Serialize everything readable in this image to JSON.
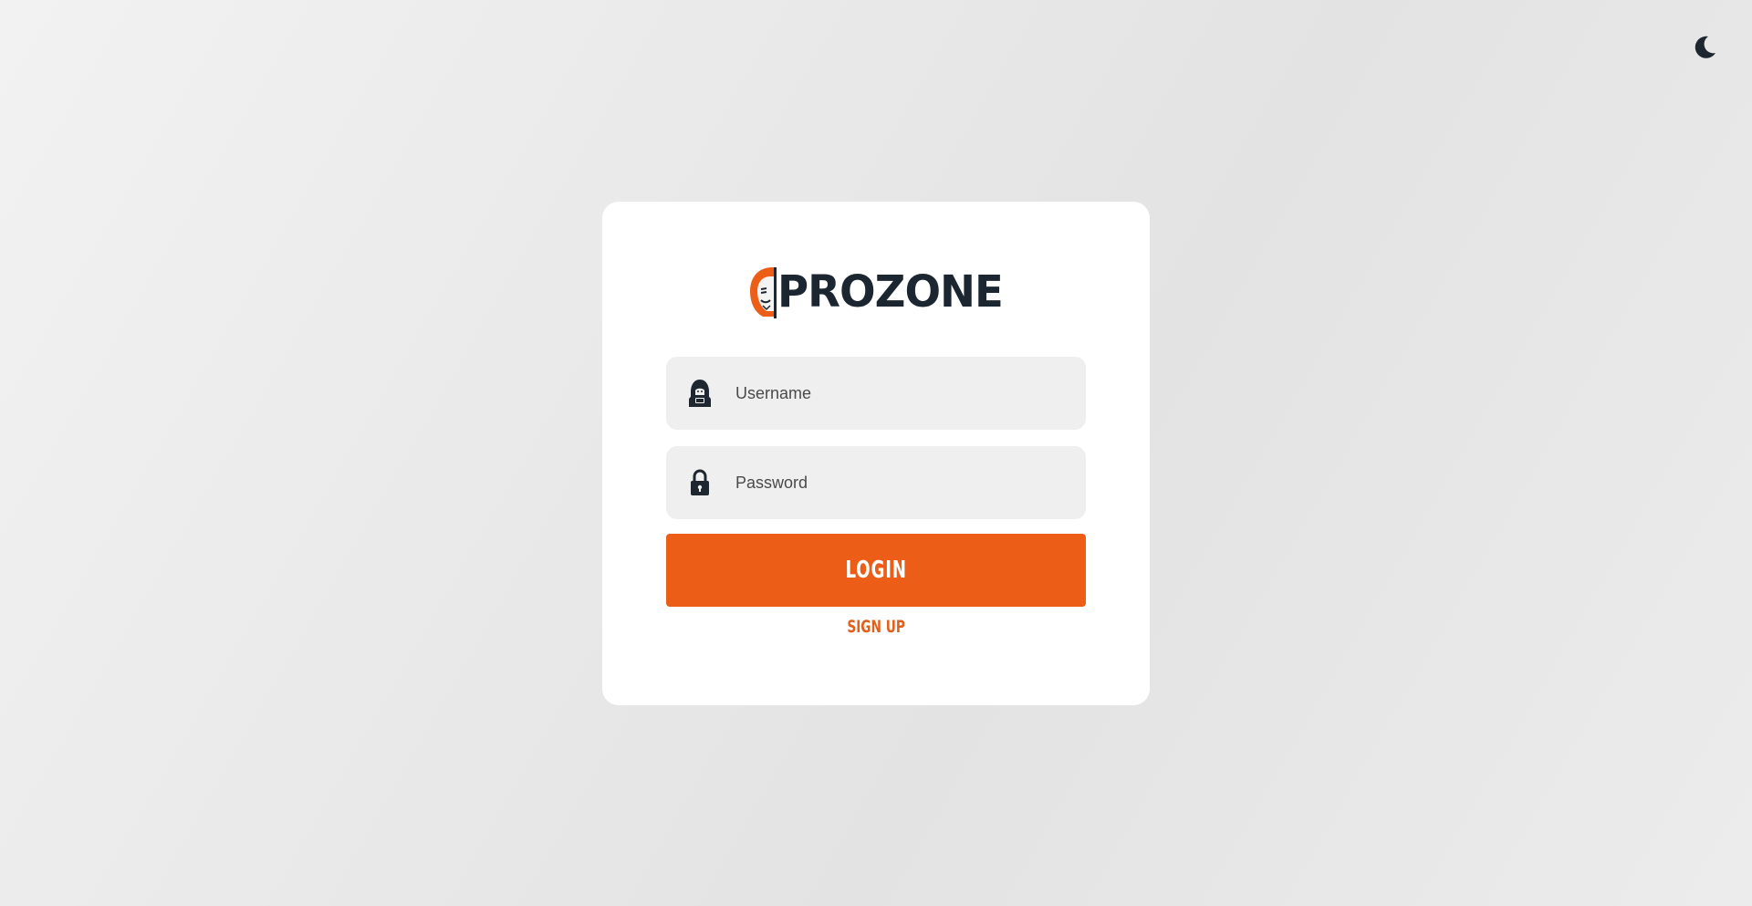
{
  "header": {
    "theme_toggle_icon": "moon-icon"
  },
  "brand": {
    "name": "PROZONE",
    "logo_icon": "hooded-mask-icon",
    "accent_color": "#ec5e17",
    "text_color": "#1c2630"
  },
  "login_form": {
    "username": {
      "icon": "hacker-avatar-icon",
      "placeholder": "Username",
      "value": ""
    },
    "password": {
      "icon": "lock-icon",
      "placeholder": "Password",
      "value": ""
    },
    "login_label": "LOGIN",
    "signup_label": "SIGN UP"
  }
}
